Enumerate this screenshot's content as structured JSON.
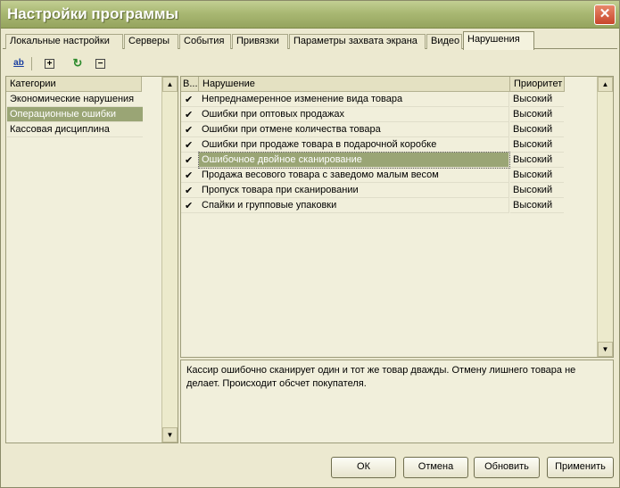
{
  "window": {
    "title": "Настройки программы",
    "close_glyph": "✕"
  },
  "tabs": [
    {
      "label": "Локальные настройки"
    },
    {
      "label": "Серверы"
    },
    {
      "label": "События"
    },
    {
      "label": "Привязки"
    },
    {
      "label": "Параметры захвата экрана"
    },
    {
      "label": "Видео"
    },
    {
      "label": "Нарушения"
    }
  ],
  "active_tab": "Нарушения",
  "toolbar": {
    "rename_icon": "ab",
    "add_icon": "+",
    "refresh_icon": "↻",
    "remove_icon": "−"
  },
  "categories": {
    "header": "Категории",
    "items": [
      {
        "label": "Экономические нарушения"
      },
      {
        "label": "Операционные ошибки"
      },
      {
        "label": "Кассовая дисциплина"
      }
    ],
    "selected": "Операционные ошибки"
  },
  "violations": {
    "headers": {
      "enabled": "В...",
      "name": "Нарушение",
      "priority": "Приоритет"
    },
    "rows": [
      {
        "checked": "✔",
        "name": "Непреднамеренное изменение вида товара",
        "priority": "Высокий"
      },
      {
        "checked": "✔",
        "name": "Ошибки при оптовых продажах",
        "priority": "Высокий"
      },
      {
        "checked": "✔",
        "name": "Ошибки при отмене количества товара",
        "priority": "Высокий"
      },
      {
        "checked": "✔",
        "name": "Ошибки при продаже товара в подарочной коробке",
        "priority": "Высокий"
      },
      {
        "checked": "✔",
        "name": "Ошибочное двойное сканирование",
        "priority": "Высокий"
      },
      {
        "checked": "✔",
        "name": "Продажа весового товара с заведомо малым весом",
        "priority": "Высокий"
      },
      {
        "checked": "✔",
        "name": "Пропуск товара при сканировании",
        "priority": "Высокий"
      },
      {
        "checked": "✔",
        "name": "Спайки и групповые упаковки",
        "priority": "Высокий"
      }
    ],
    "selected": "Ошибочное двойное сканирование"
  },
  "description": {
    "line1": "Кассир ошибочно сканирует один и тот же товар дважды. Отмену лишнего товара не",
    "line2": "делает. Происходит обсчет покупателя."
  },
  "buttons": {
    "ok": "ОК",
    "cancel": "Отмена",
    "refresh": "Обновить",
    "apply": "Применить"
  },
  "colors": {
    "title_bar": "#a9b873",
    "selection": "#9aa575",
    "window_bg": "#ece9d0"
  }
}
